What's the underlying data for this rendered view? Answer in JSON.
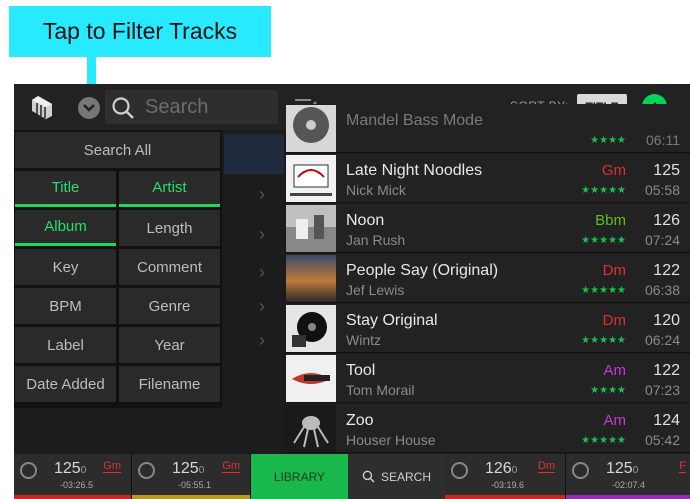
{
  "callout": {
    "text": "Tap to Filter Tracks"
  },
  "topbar": {
    "search_placeholder": "Search",
    "sort_by_label": "SORT BY:",
    "sort_value": "TITLE"
  },
  "filter": {
    "search_all": "Search All",
    "title": "Title",
    "artist": "Artist",
    "album": "Album",
    "length": "Length",
    "key": "Key",
    "comment": "Comment",
    "bpm": "BPM",
    "genre": "Genre",
    "label": "Label",
    "year": "Year",
    "date_added": "Date Added",
    "filename": "Filename"
  },
  "tracks": [
    {
      "title": "Mandel Bass Mode",
      "artist": "",
      "key": "",
      "stars": "★★★★",
      "bpm": "",
      "length": "06:11",
      "key_color": "#e03030"
    },
    {
      "title": "Late Night Noodles",
      "artist": "Nick Mick",
      "key": "Gm",
      "stars": "★★★★★",
      "bpm": "125",
      "length": "05:58",
      "key_color": "#e03030"
    },
    {
      "title": "Noon",
      "artist": "Jan Rush",
      "key": "Bbm",
      "stars": "★★★★★",
      "bpm": "126",
      "length": "07:24",
      "key_color": "#5fbf1f"
    },
    {
      "title": "People Say (Original)",
      "artist": "Jef Lewis",
      "key": "Dm",
      "stars": "★★★★★",
      "bpm": "122",
      "length": "06:38",
      "key_color": "#e03030"
    },
    {
      "title": "Stay Original",
      "artist": "Wintz",
      "key": "Dm",
      "stars": "★★★★★",
      "bpm": "120",
      "length": "06:24",
      "key_color": "#e03030"
    },
    {
      "title": "Tool",
      "artist": "Tom Morail",
      "key": "Am",
      "stars": "★★★★",
      "bpm": "122",
      "length": "07:23",
      "key_color": "#c43ad8"
    },
    {
      "title": "Zoo",
      "artist": "Houser House",
      "key": "Am",
      "stars": "★★★★★",
      "bpm": "124",
      "length": "05:42",
      "key_color": "#c43ad8"
    }
  ],
  "bottombar": {
    "decks": [
      {
        "bpm": "125",
        "bpm_dec": "0",
        "key": "Gm",
        "time": "-03:26.5",
        "color": "#c62828"
      },
      {
        "bpm": "125",
        "bpm_dec": "0",
        "key": "Gm",
        "time": "-05:55.1",
        "color": "#b59a2a"
      },
      {
        "bpm": "126",
        "bpm_dec": "0",
        "key": "Dm",
        "time": "-03:19.6",
        "color": "#c62828"
      },
      {
        "bpm": "125",
        "bpm_dec": "0",
        "key": "F",
        "time": "-02:07.4",
        "color": "#8e2fb0"
      }
    ],
    "library_label": "LIBRARY",
    "search_label": "SEARCH"
  },
  "colors": {
    "accent": "#1ed760",
    "callout": "#27e9ff"
  }
}
